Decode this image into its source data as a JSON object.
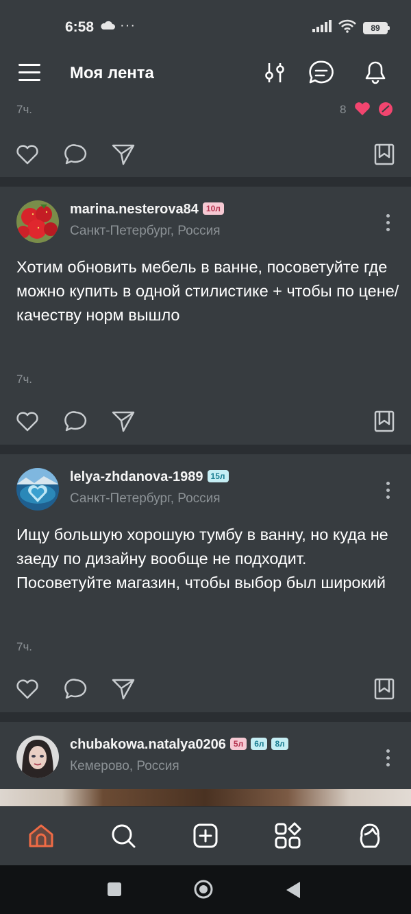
{
  "status_bar": {
    "time": "6:58",
    "more": "···",
    "battery": "89"
  },
  "app_bar": {
    "title": "Моя лента"
  },
  "previous_post": {
    "time": "7ч.",
    "likes": "8"
  },
  "posts": [
    {
      "username": "marina.nesterova84",
      "badges": [
        "10л"
      ],
      "location": "Санкт-Петербург, Россия",
      "text": "Хотим обновить мебель в ванне, посоветуйте где можно купить в одной стилистике + чтобы по цене/качеству норм вышло",
      "time": "7ч."
    },
    {
      "username": "lelya-zhdanova-1989",
      "badges": [
        "15л"
      ],
      "location": "Санкт-Петербург, Россия",
      "text": "Ищу большую хорошую тумбу в ванну, но куда не заеду по дизайну вообще не подходит. Посоветуйте магазин, чтобы выбор был широкий",
      "time": "7ч."
    },
    {
      "username": "chubakowa.natalya0206",
      "badges": [
        "5л",
        "6л",
        "8л"
      ],
      "location": "Кемерово, Россия"
    }
  ],
  "bottom_nav": [
    "home-icon",
    "search-icon",
    "add-post-icon",
    "services-icon",
    "profile-icon"
  ],
  "colors": {
    "background": "#373c40",
    "accent": "#f06b45",
    "muted": "#8c9296",
    "like_pink": "#f2456f"
  }
}
